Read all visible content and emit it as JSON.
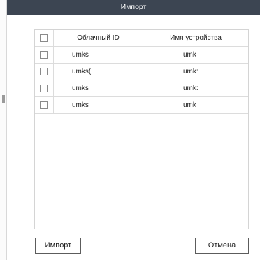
{
  "dialog": {
    "title": "Импорт"
  },
  "table": {
    "headers": {
      "cloud_id": "Облачный ID",
      "device_name": "Имя устройства"
    },
    "rows": [
      {
        "cloud_id": "umks",
        "device_name": "umk",
        "checked": false
      },
      {
        "cloud_id": "umks(",
        "device_name": "umk:",
        "checked": false
      },
      {
        "cloud_id": "umks",
        "device_name": "umk:",
        "checked": false
      },
      {
        "cloud_id": "umks",
        "device_name": "umk",
        "checked": false
      }
    ]
  },
  "buttons": {
    "import_label": "Импорт",
    "cancel_label": "Отмена"
  }
}
